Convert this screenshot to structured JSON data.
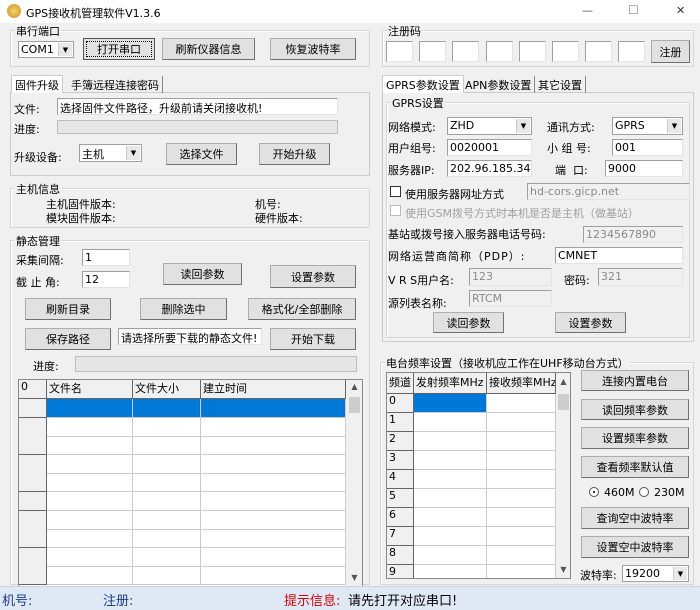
{
  "window": {
    "title": "GPS接收机管理软件V1.3.6",
    "minimize": "—",
    "maximize": "☐",
    "close": "✕"
  },
  "serial": {
    "group": "串行端口",
    "port": "COM1",
    "open": "打开串口",
    "refresh": "刷新仪器信息",
    "restore_baud": "恢复波特率"
  },
  "left_tabs": [
    "固件升级",
    "手簿远程连接密码"
  ],
  "firmware": {
    "file_label": "文件:",
    "file_value": "选择固件文件路径，升级前请关闭接收机!",
    "progress_label": "进度:",
    "progress": 0,
    "device_label": "升级设备:",
    "device": "主机",
    "choose": "选择文件",
    "start": "开始升级"
  },
  "host": {
    "group": "主机信息",
    "fw": "主机固件版本:",
    "module_fw": "模块固件版本:",
    "sn": "机号:",
    "hw": "硬件版本:"
  },
  "static": {
    "group": "静态管理",
    "interval_label": "采集间隔:",
    "interval": "1",
    "cutoff_label": "截 止 角:",
    "cutoff": "12",
    "read": "读回参数",
    "set": "设置参数",
    "refresh_dir": "刷新目录",
    "delete": "删除选中",
    "format": "格式化/全部删除",
    "save_path": "保存路径",
    "hint": "请选择所要下载的静态文件!",
    "download": "开始下载",
    "progress_label": "进度:",
    "progress": 0,
    "columns": [
      "0",
      "文件名",
      "文件大小",
      "建立时间"
    ]
  },
  "reg": {
    "group": "注册码",
    "button": "注册",
    "codes": [
      "",
      "",
      "",
      "",
      "",
      "",
      "",
      ""
    ]
  },
  "right_tabs": [
    "GPRS参数设置",
    "APN参数设置",
    "其它设置"
  ],
  "gprs": {
    "group": "GPRS设置",
    "net_mode_label": "网络模式:",
    "net_mode": "ZHD",
    "comm_label": "通讯方式:",
    "comm": "GPRS",
    "user_group_label": "用户组号:",
    "user_group": "0020001",
    "sub_group_label": "小 组 号:",
    "sub_group": "001",
    "ip_label": "服务器IP:",
    "ip": "202.96.185.34",
    "port_label": "端  口:",
    "port": "9000",
    "use_url_label": "使用服务器网址方式",
    "use_url": false,
    "url": "hd-cors.gicp.net",
    "gsm_label": "使用GSM拨号方式时本机是否是主机（做基站）",
    "gsm": false,
    "phone_label": "基站或拨号接入服务器电话号码:",
    "phone": "1234567890",
    "pdp_label": "网络运营商简称（PDP）:",
    "pdp": "CMNET",
    "vrs_user_label": "V R S用户名:",
    "vrs_user": "123",
    "pwd_label": "密码:",
    "pwd": "321",
    "source_label": "源列表名称:",
    "source": "RTCM",
    "read": "读回参数",
    "set": "设置参数"
  },
  "radio": {
    "group": "电台频率设置（接收机应工作在UHF移动台方式）",
    "columns": [
      "频道",
      "发射频率MHz",
      "接收频率MHz"
    ],
    "channels": [
      "0",
      "1",
      "2",
      "3",
      "4",
      "5",
      "6",
      "7",
      "8",
      "9"
    ],
    "connect": "连接内置电台",
    "read": "读回频率参数",
    "set": "设置频率参数",
    "defaults": "查看频率默认值",
    "opt1": "460M",
    "opt2": "230M",
    "selected": "460M",
    "query_air": "查询空中波特率",
    "set_air": "设置空中波特率",
    "baud_label": "波特率:",
    "baud": "19200"
  },
  "status": {
    "sn": "机号:",
    "reg": "注册:",
    "hint_label": "提示信息:",
    "hint": "请先打开对应串口!",
    "hint_color": "#e00000"
  }
}
